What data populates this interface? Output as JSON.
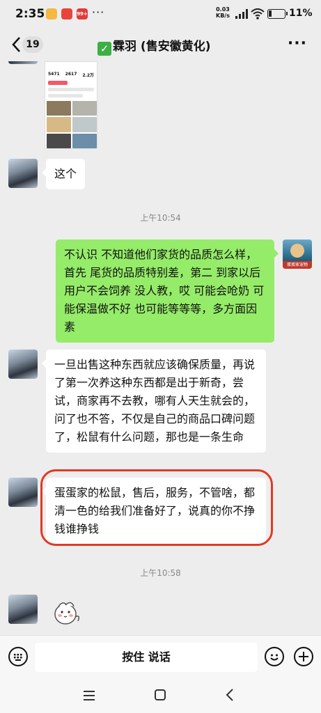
{
  "status_bar": {
    "time": "2:35",
    "net_speed_value": "0.03",
    "net_speed_unit": "KB/s",
    "network_type": "4G",
    "battery": "11%",
    "notif_badge": "99+"
  },
  "header": {
    "unread_count": "19",
    "title": "霖羽 (售安徽黄化)",
    "menu_icon": "more-icon"
  },
  "messages": [
    {
      "type": "image",
      "side": "left",
      "stats": [
        "5471",
        "2617",
        "2.2万"
      ]
    },
    {
      "type": "text",
      "side": "left",
      "text": "这个"
    },
    {
      "type": "time",
      "text": "上午10:54"
    },
    {
      "type": "text",
      "side": "right",
      "text": "不认识 不知道他们家货的品质怎么样，首先 尾货的品质特别差，第二 到家以后用户不会饲养 没人教，哎 可能会呛奶 可能保温做不好 也可能等等等，多方面因素",
      "avatar_caption": "蛋蛋家宠物"
    },
    {
      "type": "text",
      "side": "left",
      "text": "一旦出售这种东西就应该确保质量，再说了第一次养这种东西都是出于新奇，尝试，商家再不去教，哪有人天生就会的，问了也不答，不仅是自己的商品口碑问题了，松鼠有什么问题，那也是一条生命"
    },
    {
      "type": "text",
      "side": "left",
      "text": "蛋蛋家的松鼠，售后，服务，不管啥，都清一色的给我们准备好了，说真的你不挣钱谁挣钱",
      "highlighted": true
    },
    {
      "type": "time",
      "text": "上午10:58"
    },
    {
      "type": "sticker",
      "side": "left",
      "icon": "cartoon-sticker-icon"
    }
  ],
  "input_bar": {
    "hold_to_talk": "按住 说话",
    "icons": [
      "keyboard-icon",
      "emoji-icon",
      "plus-icon"
    ]
  },
  "nav_bar": {
    "icons": [
      "menu-icon",
      "home-icon",
      "back-icon"
    ]
  },
  "colors": {
    "background": "#ededed",
    "bubble_self": "#95ec69",
    "bubble_other": "#ffffff",
    "highlight": "#e03a24"
  }
}
